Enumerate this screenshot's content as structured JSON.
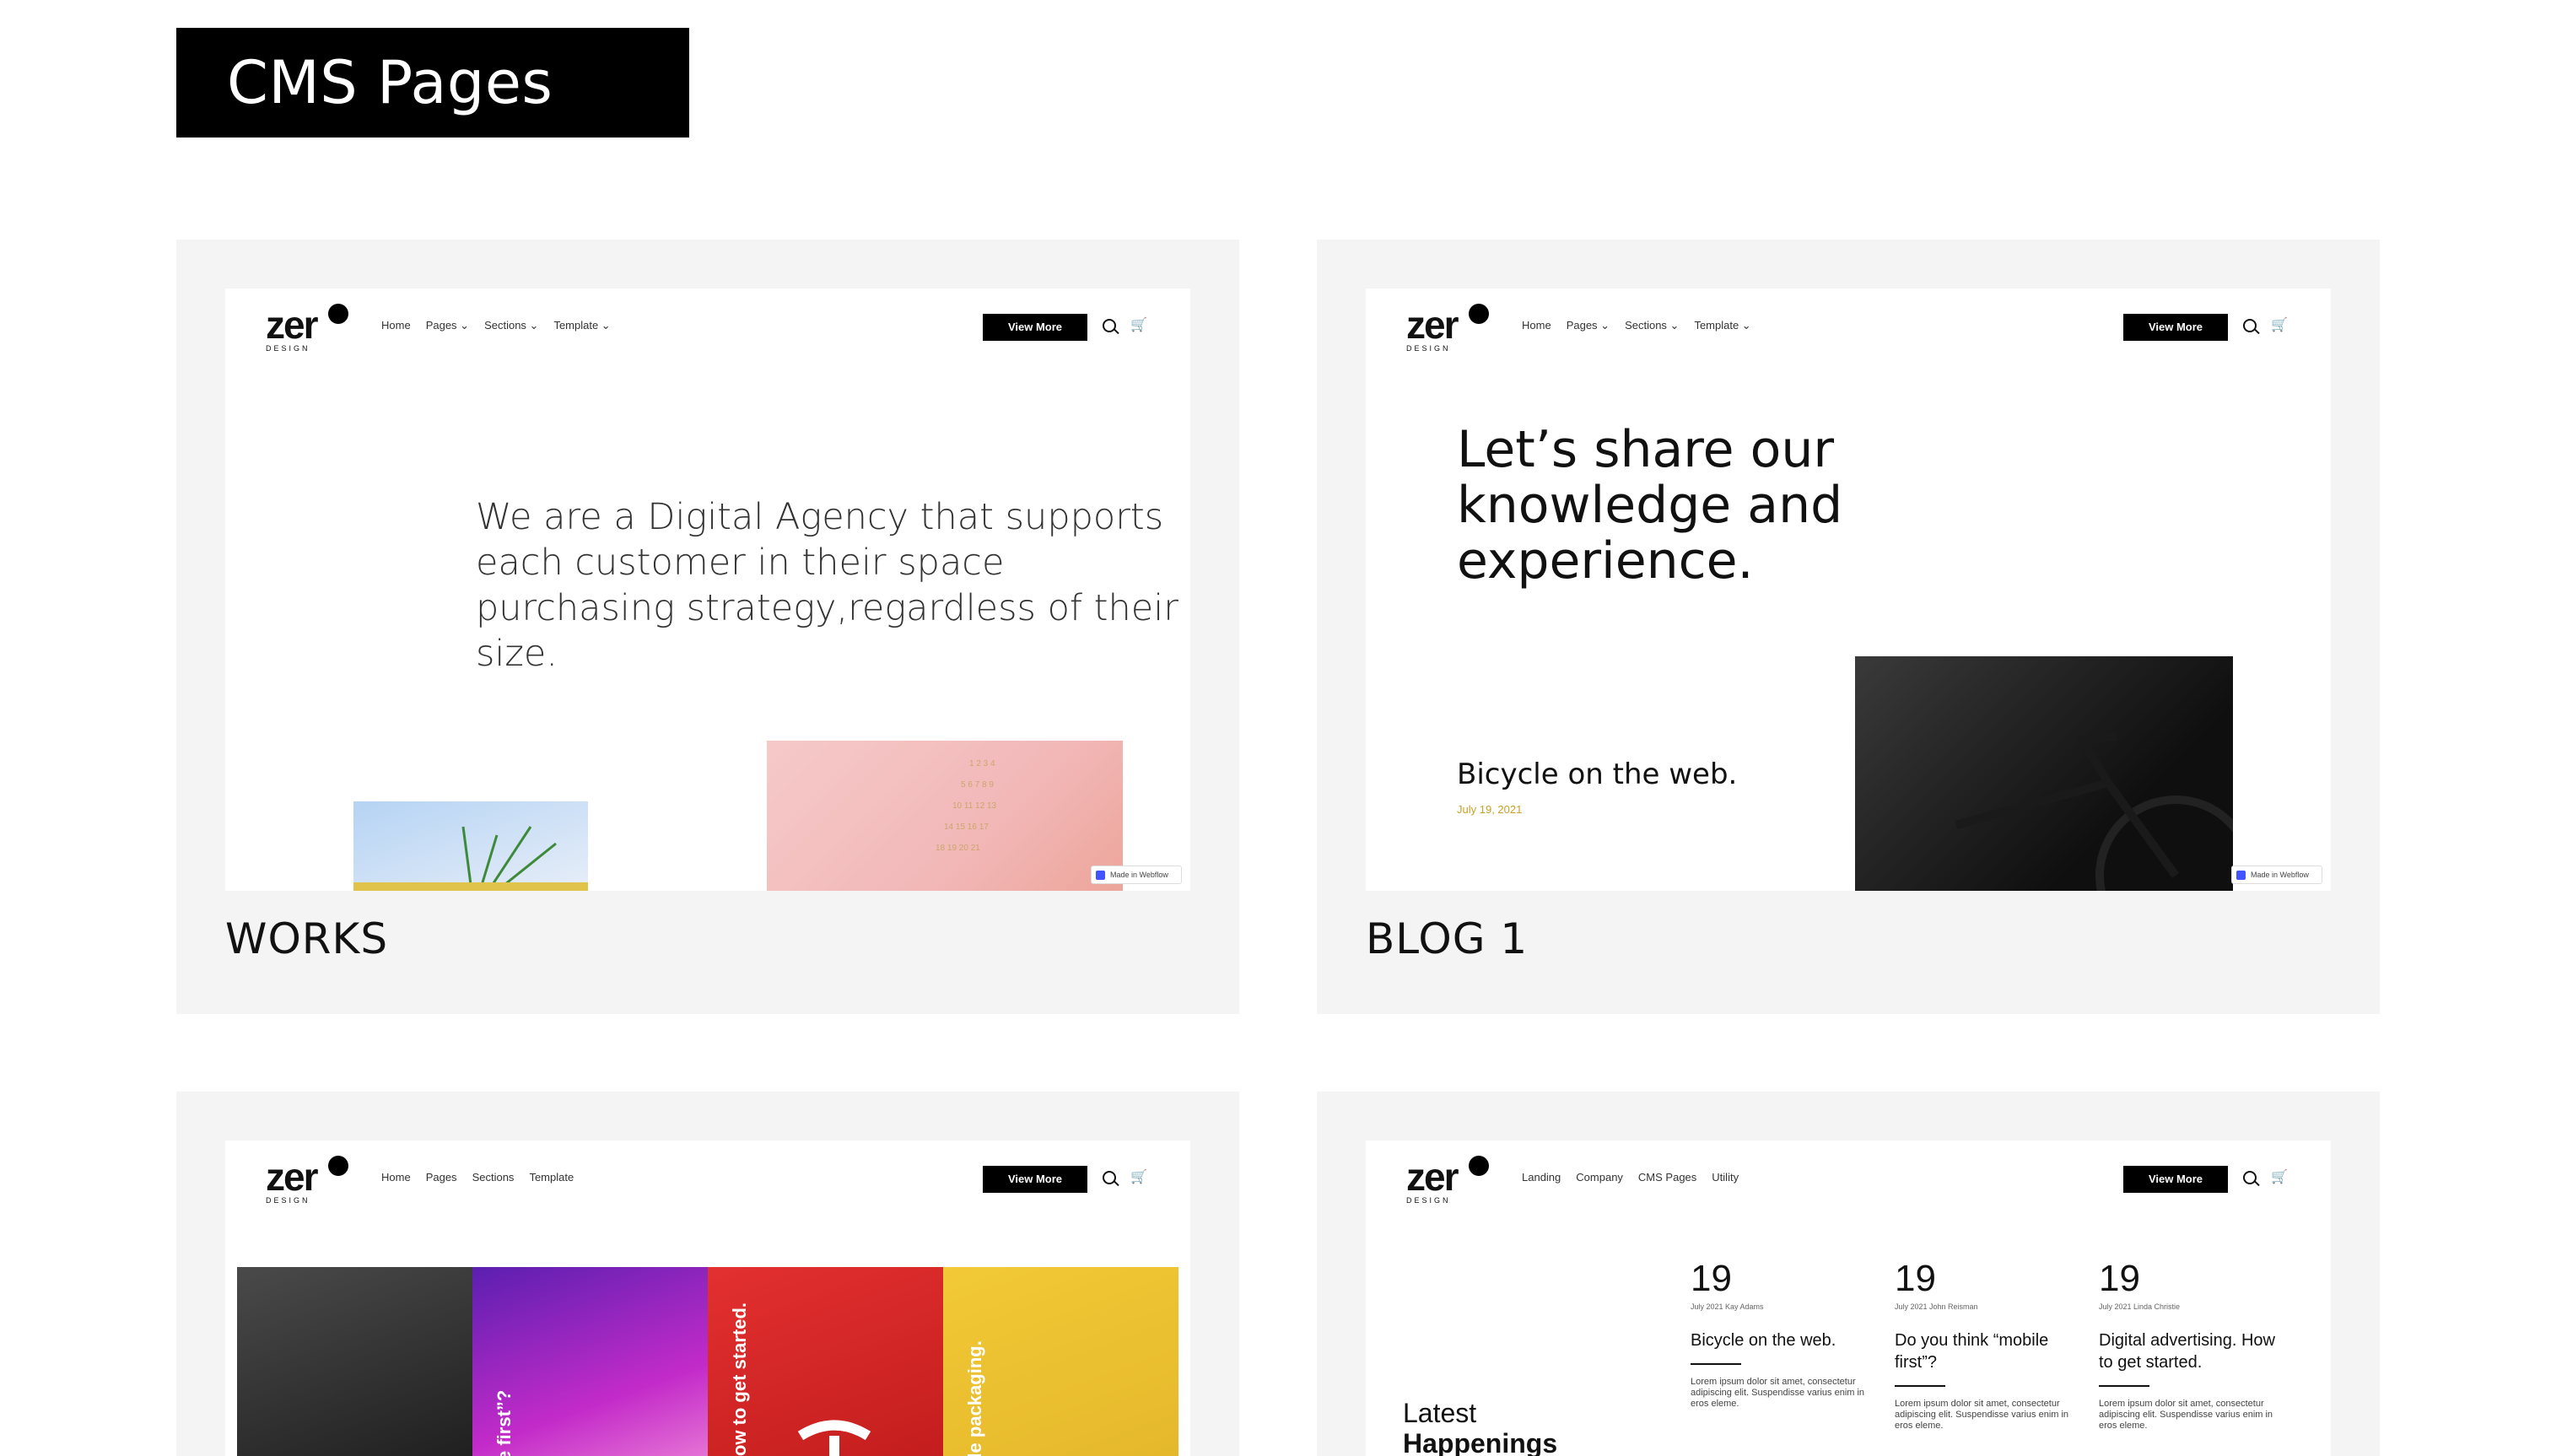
{
  "page": {
    "title": "CMS Pages"
  },
  "nav_common": {
    "logo_text": "zer",
    "logo_sub": "DESIGN",
    "cta": "View More",
    "dropdown_links": [
      "Home",
      "Pages ⌄",
      "Sections ⌄",
      "Template ⌄"
    ],
    "plain_links": [
      "Home",
      "Pages",
      "Sections",
      "Template"
    ],
    "alt_links": [
      "Landing",
      "Company",
      "CMS Pages",
      "Utility"
    ]
  },
  "badge": "Made in Webflow",
  "cards": [
    {
      "caption": "WORKS",
      "hero": "We are a Digital Agency that supports each customer in their space purchasing strategy,regardless of their size."
    },
    {
      "caption": "BLOG 1",
      "hero": "Let’s share our knowledge and experience.",
      "post_title": "Bicycle on the web.",
      "post_date": "July 19, 2021"
    },
    {
      "caption": "",
      "tile_texts": [
        "e first”?",
        "How to get started.",
        "ole packaging."
      ]
    },
    {
      "caption": "",
      "heading_line1": "Latest",
      "heading_line2": "Happenings",
      "posts": [
        {
          "day": "19",
          "meta": "July 2021    Kay Adams",
          "title": "Bicycle on the web.",
          "excerpt": "Lorem ipsum dolor sit amet, consectetur adipiscing elit. Suspendisse varius enim in eros eleme."
        },
        {
          "day": "19",
          "meta": "July 2021    John Reisman",
          "title": "Do you think “mobile first”?",
          "excerpt": "Lorem ipsum dolor sit amet, consectetur adipiscing elit. Suspendisse varius enim in eros eleme."
        },
        {
          "day": "19",
          "meta": "July 2021    Linda Christie",
          "title": "Digital advertising. How to get started.",
          "excerpt": "Lorem ipsum dolor sit amet, consectetur adipiscing elit. Suspendisse varius enim in eros eleme."
        }
      ]
    }
  ]
}
